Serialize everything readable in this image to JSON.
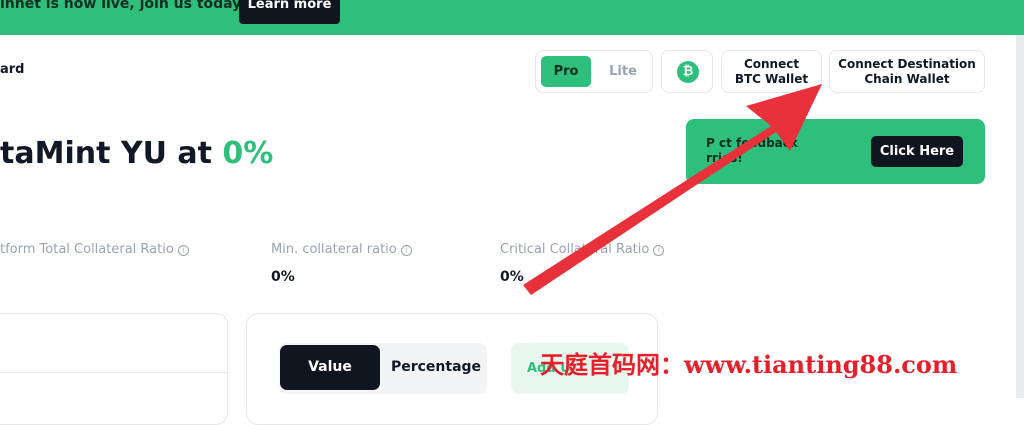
{
  "banner": {
    "text": "innet is now live, join us today!",
    "learn_more": "Learn more"
  },
  "breadcrumb": "ard",
  "mode_toggle": {
    "pro": "Pro",
    "lite": "Lite",
    "active": "Pro"
  },
  "btc_icon": "₿",
  "connect_btc": "Connect\nBTC Wallet",
  "connect_destination": "Connect Destination\nChain Wallet",
  "headline": {
    "text": "taMint YU at ",
    "percent": "0%"
  },
  "feedback": {
    "text": "P        ct feedback\n          rries!",
    "button": "Click Here"
  },
  "stats": [
    {
      "label": "tform Total Collateral Ratio",
      "value": ""
    },
    {
      "label": "Min. collateral ratio",
      "value": "0%"
    },
    {
      "label": "Critical Collateral Ratio",
      "value": "0%"
    }
  ],
  "view_toggle": {
    "value": "Value",
    "percentage": "Percentage",
    "active": "Value"
  },
  "add_button": "Add U",
  "watermark": "天庭首码网：www.tianting88.com",
  "colors": {
    "accent": "#2ebf7c",
    "dark": "#0f1620",
    "arrow": "#e8313b"
  }
}
